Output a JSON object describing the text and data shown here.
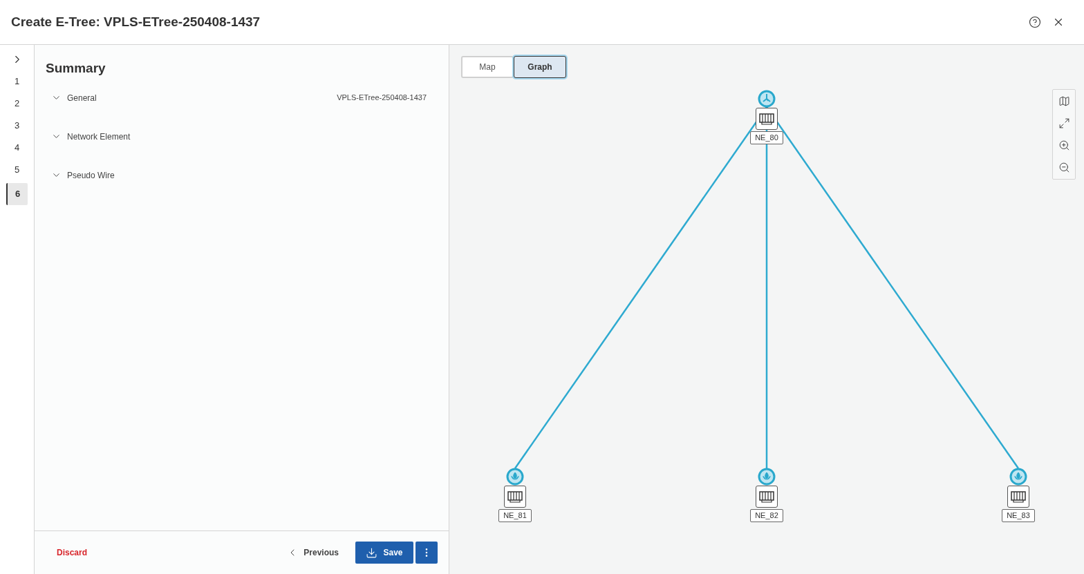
{
  "window": {
    "title": "Create E-Tree: VPLS-ETree-250408-1437"
  },
  "steps": [
    {
      "label": "1",
      "selected": false
    },
    {
      "label": "2",
      "selected": false
    },
    {
      "label": "3",
      "selected": false
    },
    {
      "label": "4",
      "selected": false
    },
    {
      "label": "5",
      "selected": false
    },
    {
      "label": "6",
      "selected": true
    }
  ],
  "summary": {
    "title": "Summary",
    "sections": [
      {
        "label": "General",
        "value": "VPLS-ETree-250408-1437",
        "expanded": false
      },
      {
        "label": "Network Element",
        "expanded": false
      },
      {
        "label": "Pseudo Wire",
        "expanded": false
      }
    ]
  },
  "footer": {
    "discard": "Discard",
    "previous": "Previous",
    "save": "Save"
  },
  "view_tabs": [
    {
      "label": "Map",
      "selected": false
    },
    {
      "label": "Graph",
      "selected": true
    }
  ],
  "graph": {
    "nodes": [
      {
        "kind": "hub",
        "label": "NE_80"
      },
      {
        "kind": "leaf",
        "label": "NE_81"
      },
      {
        "kind": "leaf",
        "label": "NE_82"
      },
      {
        "kind": "leaf",
        "label": "NE_83"
      }
    ]
  }
}
